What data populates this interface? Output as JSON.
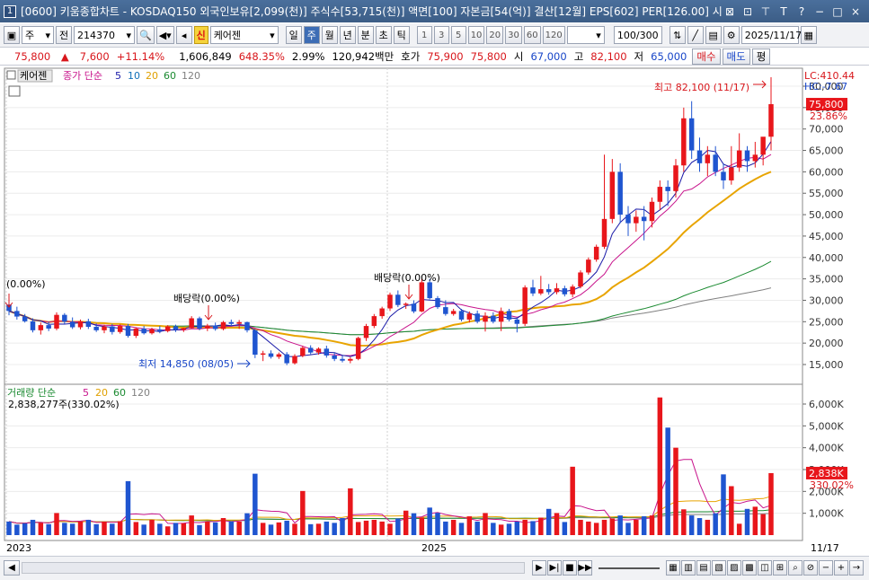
{
  "window": {
    "number": "1",
    "title": "[0600] 키움종합차트 - KOSDAQ150 외국인보유[2,099(천)] 주식수[53,715(천)] 액면[100] 자본금[54(억)] 결산[12월] EPS[602] PER[126.00] 시",
    "controls": [
      "⊠",
      "⊡",
      "⊤",
      "T",
      "?",
      "−",
      "□",
      "×"
    ]
  },
  "toolbar": {
    "market_type": "주",
    "scope": "전",
    "code": "214370",
    "new_badge": "신",
    "stock_name": "케어젠",
    "periods": [
      {
        "label": "일",
        "active": false
      },
      {
        "label": "주",
        "active": true
      },
      {
        "label": "월",
        "active": false
      },
      {
        "label": "년",
        "active": false
      },
      {
        "label": "분",
        "active": false
      },
      {
        "label": "초",
        "active": false
      },
      {
        "label": "틱",
        "active": false
      }
    ],
    "intervals": [
      "1",
      "3",
      "5",
      "10",
      "20",
      "30",
      "60",
      "120"
    ],
    "count": "100",
    "count_max": "/300",
    "date": "2025/11/17"
  },
  "quote": {
    "price": "75,800",
    "arrow": "▲",
    "change": "7,600",
    "change_pct": "+11.14%",
    "volume": "1,606,849",
    "volume_ratio": "648.35%",
    "turnover": "2.99%",
    "amount": "120,942백만",
    "hoga_label": "호가",
    "ask": "75,900",
    "bid": "75,800",
    "open_label": "시",
    "open": "67,000",
    "high_label": "고",
    "high": "82,100",
    "low_label": "저",
    "low": "65,000",
    "buy_btn": "매수",
    "sell_btn": "매도",
    "eval_btn": "평"
  },
  "price_panel": {
    "name_tag": "케어젠",
    "indicator": "종가 단순",
    "ma_periods": [
      {
        "label": "5",
        "color": "#1a1aa8"
      },
      {
        "label": "10",
        "color": "#0f6fb8"
      },
      {
        "label": "20",
        "color": "#e0a000"
      },
      {
        "label": "60",
        "color": "#1a8a30"
      },
      {
        "label": "120",
        "color": "#808080"
      }
    ],
    "lc": "LC:410.44",
    "hc": "HC:-7.67",
    "cur_label": "75,800",
    "cur_pct": "23.86%",
    "max_annotation": "최고 82,100 (11/17)",
    "min_annotation": "최저 14,850 (08/05)",
    "start_annotation": "(0.00%)",
    "div_annotations": [
      "배당락(0.00%)",
      "배당락(0.00%)"
    ],
    "axis_labels": [
      "80,000",
      "75,000",
      "70,000",
      "65,000",
      "60,000",
      "55,000",
      "50,000",
      "45,000",
      "40,000",
      "35,000",
      "30,000",
      "25,000",
      "20,000",
      "15,000"
    ]
  },
  "volume_panel": {
    "indicator": "거래량 단순",
    "ma_periods": [
      {
        "label": "5",
        "color": "#c8148c"
      },
      {
        "label": "20",
        "color": "#e0a000"
      },
      {
        "label": "60",
        "color": "#1a8a30"
      },
      {
        "label": "120",
        "color": "#808080"
      }
    ],
    "value_text": "2,838,277주(330.02%)",
    "cur_label": "2,838K",
    "cur_pct": "330.02%",
    "axis_labels": [
      "6,000K",
      "5,000K",
      "4,000K",
      "3,000K",
      "2,000K",
      "1,000K"
    ]
  },
  "x_axis": {
    "labels": [
      "2023",
      "2025"
    ],
    "right_label": "11/17"
  },
  "colors": {
    "up": "#e8161b",
    "down": "#1f55d0",
    "ma5": "#1a1aa8",
    "ma10": "#c8148c",
    "ma20": "#e8a400",
    "ma60": "#1a8a30",
    "ma120": "#808080"
  },
  "chart_data": {
    "type": "candlestick",
    "weeks": 100,
    "candles": [
      [
        29000,
        29500,
        26500,
        27500
      ],
      [
        27500,
        28500,
        25500,
        26200
      ],
      [
        26200,
        26800,
        24800,
        25100
      ],
      [
        25100,
        25800,
        22500,
        23000
      ],
      [
        23000,
        24800,
        22000,
        24200
      ],
      [
        24200,
        25000,
        22800,
        23400
      ],
      [
        23400,
        27200,
        23000,
        26600
      ],
      [
        26600,
        27000,
        24500,
        25000
      ],
      [
        25000,
        26000,
        23300,
        23700
      ],
      [
        23700,
        25500,
        23200,
        25100
      ],
      [
        25100,
        25700,
        23300,
        23800
      ],
      [
        23800,
        24600,
        22600,
        23000
      ],
      [
        23000,
        24300,
        22300,
        23900
      ],
      [
        23900,
        24500,
        22000,
        22600
      ],
      [
        22600,
        24400,
        22200,
        24000
      ],
      [
        24000,
        24500,
        21300,
        21700
      ],
      [
        21700,
        23700,
        21200,
        23400
      ],
      [
        23400,
        24000,
        22000,
        22300
      ],
      [
        22300,
        23600,
        22000,
        23200
      ],
      [
        23200,
        24000,
        22300,
        22800
      ],
      [
        22800,
        24200,
        22500,
        23900
      ],
      [
        23900,
        24300,
        22600,
        23100
      ],
      [
        23100,
        23600,
        22600,
        23500
      ],
      [
        23500,
        26300,
        23300,
        25800
      ],
      [
        25800,
        26200,
        23000,
        23400
      ],
      [
        23400,
        24500,
        22800,
        24100
      ],
      [
        24100,
        24800,
        22900,
        23300
      ],
      [
        23300,
        25200,
        23000,
        24900
      ],
      [
        24900,
        25500,
        24000,
        24500
      ],
      [
        24500,
        25400,
        23300,
        24900
      ],
      [
        24900,
        25000,
        22500,
        23000
      ],
      [
        23000,
        23300,
        16500,
        17300
      ],
      [
        17300,
        18200,
        15800,
        17600
      ],
      [
        17600,
        18300,
        16400,
        16800
      ],
      [
        16800,
        17800,
        16300,
        17400
      ],
      [
        17400,
        17900,
        14850,
        15300
      ],
      [
        15300,
        17400,
        15000,
        17000
      ],
      [
        17000,
        19300,
        16700,
        18900
      ],
      [
        18900,
        19500,
        17400,
        17800
      ],
      [
        17800,
        19000,
        17300,
        18700
      ],
      [
        18700,
        19400,
        16600,
        17100
      ],
      [
        17100,
        17700,
        15800,
        16300
      ],
      [
        16300,
        17100,
        15500,
        15900
      ],
      [
        15900,
        16700,
        15300,
        16300
      ],
      [
        16300,
        21500,
        16000,
        21200
      ],
      [
        21200,
        24500,
        20500,
        24000
      ],
      [
        24000,
        26800,
        23500,
        26300
      ],
      [
        26300,
        28500,
        25700,
        28100
      ],
      [
        28100,
        31800,
        27500,
        31300
      ],
      [
        31300,
        32300,
        28400,
        28900
      ],
      [
        28900,
        29500,
        28000,
        29200
      ],
      [
        29200,
        30000,
        27000,
        27400
      ],
      [
        27400,
        35000,
        27200,
        34200
      ],
      [
        34200,
        35000,
        30200,
        30500
      ],
      [
        30500,
        31000,
        28000,
        28400
      ],
      [
        28400,
        30000,
        26400,
        26800
      ],
      [
        26800,
        28000,
        26400,
        27500
      ],
      [
        27500,
        28000,
        25100,
        25500
      ],
      [
        25500,
        27400,
        24800,
        26900
      ],
      [
        26900,
        27600,
        24600,
        25000
      ],
      [
        25000,
        27200,
        22700,
        26400
      ],
      [
        26400,
        27200,
        24600,
        25000
      ],
      [
        25000,
        28300,
        22800,
        27500
      ],
      [
        27500,
        28000,
        25100,
        25500
      ],
      [
        25500,
        26000,
        22500,
        24500
      ],
      [
        24500,
        33500,
        24000,
        33000
      ],
      [
        33000,
        34800,
        31000,
        31600
      ],
      [
        31600,
        35700,
        31200,
        32600
      ],
      [
        32600,
        33800,
        31300,
        31900
      ],
      [
        31900,
        34000,
        31400,
        32800
      ],
      [
        32800,
        33400,
        30900,
        31400
      ],
      [
        31400,
        33700,
        30700,
        33200
      ],
      [
        33200,
        37000,
        32800,
        36500
      ],
      [
        36500,
        40000,
        36000,
        39500
      ],
      [
        39500,
        43000,
        39000,
        42500
      ],
      [
        42500,
        64000,
        42000,
        49000
      ],
      [
        49000,
        63000,
        48000,
        60000
      ],
      [
        60000,
        62000,
        48000,
        50000
      ],
      [
        50000,
        52000,
        45000,
        48000
      ],
      [
        48000,
        51000,
        46000,
        49500
      ],
      [
        49500,
        52000,
        44000,
        48500
      ],
      [
        48500,
        54000,
        47000,
        53000
      ],
      [
        53000,
        58000,
        51000,
        56500
      ],
      [
        56500,
        58000,
        52000,
        55500
      ],
      [
        55500,
        63000,
        54000,
        61500
      ],
      [
        61500,
        75000,
        60000,
        72500
      ],
      [
        72500,
        76500,
        63000,
        65000
      ],
      [
        65000,
        68000,
        60000,
        62000
      ],
      [
        62000,
        66000,
        59000,
        64000
      ],
      [
        64000,
        66000,
        59000,
        60000
      ],
      [
        60000,
        62000,
        56000,
        58000
      ],
      [
        58000,
        66000,
        57000,
        61000
      ],
      [
        61000,
        69000,
        60000,
        65000
      ],
      [
        65000,
        66000,
        60000,
        62500
      ],
      [
        62500,
        67000,
        61000,
        64000
      ],
      [
        64000,
        67500,
        61500,
        68200
      ],
      [
        68200,
        82100,
        65000,
        75800
      ]
    ],
    "volume_k": [
      620,
      480,
      540,
      700,
      560,
      500,
      1010,
      560,
      520,
      620,
      700,
      500,
      620,
      520,
      640,
      2470,
      600,
      480,
      700,
      520,
      400,
      560,
      540,
      900,
      460,
      620,
      580,
      780,
      620,
      620,
      1000,
      2810,
      560,
      480,
      580,
      660,
      520,
      2020,
      500,
      520,
      620,
      560,
      780,
      2140,
      600,
      660,
      700,
      620,
      520,
      760,
      1120,
      1000,
      800,
      1260,
      1020,
      620,
      700,
      560,
      860,
      620,
      1010,
      560,
      480,
      520,
      620,
      700,
      640,
      800,
      1200,
      1010,
      600,
      3130,
      700,
      620,
      560,
      700,
      760,
      900,
      560,
      700,
      860,
      900,
      6300,
      4920,
      4000,
      1180,
      900,
      780,
      700,
      1000,
      2780,
      2240,
      520,
      1200,
      1300,
      960,
      2838
    ]
  }
}
